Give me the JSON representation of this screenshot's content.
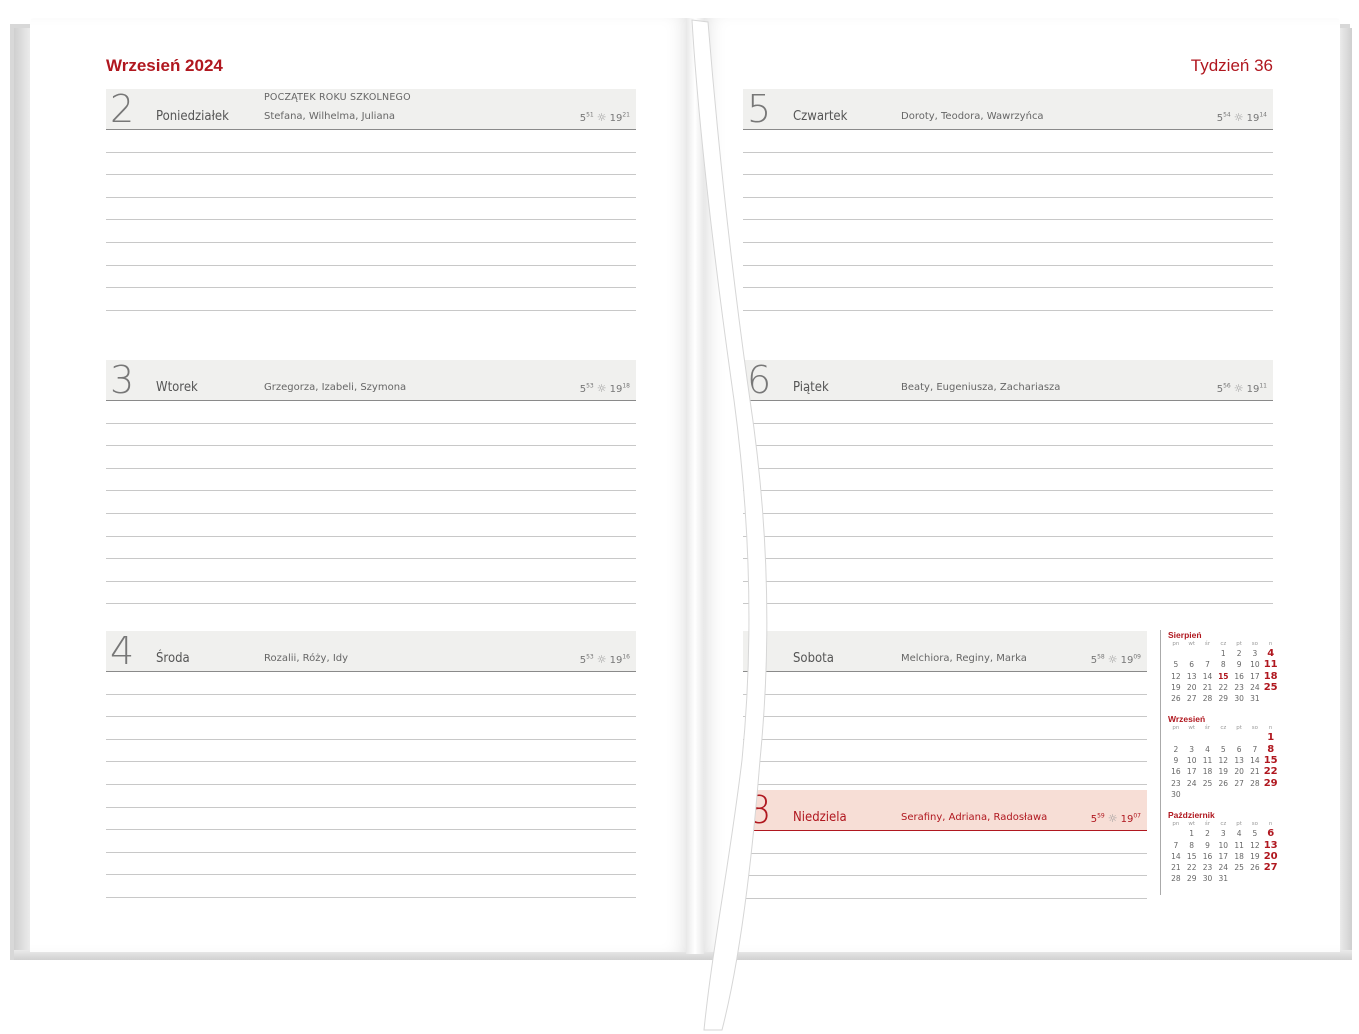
{
  "header": {
    "month": "Wrzesień 2024",
    "week": "Tydzień 36"
  },
  "days": [
    {
      "num": "2",
      "name": "Poniedziałek",
      "event": "POCZĄTEK ROKU SZKOLNEGO",
      "names": "Stefana, Wilhelma, Juliana",
      "rise": "5",
      "rise_min": "51",
      "set": "19",
      "set_min": "21"
    },
    {
      "num": "3",
      "name": "Wtorek",
      "event": "",
      "names": "Grzegorza, Izabeli, Szymona",
      "rise": "5",
      "rise_min": "53",
      "set": "19",
      "set_min": "18"
    },
    {
      "num": "4",
      "name": "Środa",
      "event": "",
      "names": "Rozalii, Róży, Idy",
      "rise": "5",
      "rise_min": "53",
      "set": "19",
      "set_min": "16"
    },
    {
      "num": "5",
      "name": "Czwartek",
      "event": "",
      "names": "Doroty, Teodora, Wawrzyńca",
      "rise": "5",
      "rise_min": "54",
      "set": "19",
      "set_min": "14"
    },
    {
      "num": "6",
      "name": "Piątek",
      "event": "",
      "names": "Beaty, Eugeniusza, Zachariasza",
      "rise": "5",
      "rise_min": "56",
      "set": "19",
      "set_min": "11"
    },
    {
      "num": "7",
      "name": "Sobota",
      "event": "",
      "names": "Melchiora, Reginy, Marka",
      "rise": "5",
      "rise_min": "58",
      "set": "19",
      "set_min": "09"
    },
    {
      "num": "8",
      "name": "Niedziela",
      "event": "",
      "names": "Serafiny, Adriana, Radosława",
      "rise": "5",
      "rise_min": "59",
      "set": "19",
      "set_min": "07"
    }
  ],
  "mini_calendar": {
    "weekday_headers": [
      "pn",
      "wt",
      "śr",
      "cz",
      "pt",
      "so",
      "n"
    ],
    "months": [
      {
        "name": "Sierpień",
        "weeks": [
          [
            "",
            "",
            "",
            "1",
            "2",
            "3",
            "4"
          ],
          [
            "5",
            "6",
            "7",
            "8",
            "9",
            "10",
            "11"
          ],
          [
            "12",
            "13",
            "14",
            "15",
            "16",
            "17",
            "18"
          ],
          [
            "19",
            "20",
            "21",
            "22",
            "23",
            "24",
            "25"
          ],
          [
            "26",
            "27",
            "28",
            "29",
            "30",
            "31",
            ""
          ]
        ],
        "holidays": [
          "15"
        ]
      },
      {
        "name": "Wrzesień",
        "weeks": [
          [
            "",
            "",
            "",
            "",
            "",
            "",
            "1"
          ],
          [
            "2",
            "3",
            "4",
            "5",
            "6",
            "7",
            "8"
          ],
          [
            "9",
            "10",
            "11",
            "12",
            "13",
            "14",
            "15"
          ],
          [
            "16",
            "17",
            "18",
            "19",
            "20",
            "21",
            "22"
          ],
          [
            "23",
            "24",
            "25",
            "26",
            "27",
            "28",
            "29"
          ],
          [
            "30",
            "",
            "",
            "",
            "",
            "",
            ""
          ]
        ],
        "holidays": []
      },
      {
        "name": "Październik",
        "weeks": [
          [
            "",
            "1",
            "2",
            "3",
            "4",
            "5",
            "6"
          ],
          [
            "7",
            "8",
            "9",
            "10",
            "11",
            "12",
            "13"
          ],
          [
            "14",
            "15",
            "16",
            "17",
            "18",
            "19",
            "20"
          ],
          [
            "21",
            "22",
            "23",
            "24",
            "25",
            "26",
            "27"
          ],
          [
            "28",
            "29",
            "30",
            "31",
            "",
            "",
            ""
          ]
        ],
        "holidays": []
      }
    ]
  }
}
